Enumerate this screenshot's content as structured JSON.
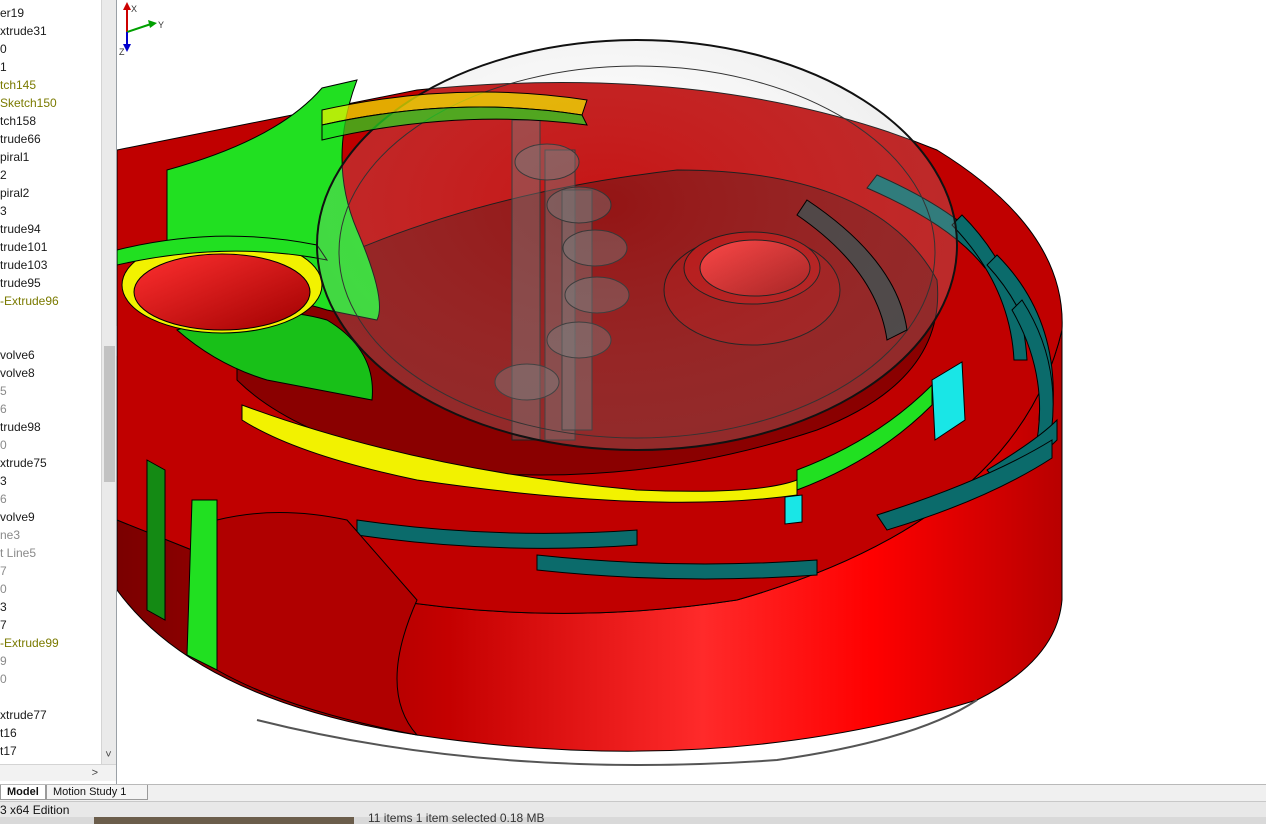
{
  "feature_tree": {
    "items": [
      {
        "label": "er19",
        "state": "normal"
      },
      {
        "label": "xtrude31",
        "state": "normal"
      },
      {
        "label": "0",
        "state": "normal"
      },
      {
        "label": "1",
        "state": "normal"
      },
      {
        "label": "tch145",
        "state": "active"
      },
      {
        "label": "Sketch150",
        "state": "active"
      },
      {
        "label": "tch158",
        "state": "normal"
      },
      {
        "label": "trude66",
        "state": "normal"
      },
      {
        "label": "piral1",
        "state": "normal"
      },
      {
        "label": "2",
        "state": "normal"
      },
      {
        "label": "piral2",
        "state": "normal"
      },
      {
        "label": "3",
        "state": "normal"
      },
      {
        "label": "trude94",
        "state": "normal"
      },
      {
        "label": "trude101",
        "state": "normal"
      },
      {
        "label": "trude103",
        "state": "normal"
      },
      {
        "label": "trude95",
        "state": "normal"
      },
      {
        "label": "-Extrude96",
        "state": "active"
      },
      {
        "label": "",
        "state": "normal"
      },
      {
        "label": "",
        "state": "normal"
      },
      {
        "label": "volve6",
        "state": "normal"
      },
      {
        "label": "volve8",
        "state": "normal"
      },
      {
        "label": "5",
        "state": "dim"
      },
      {
        "label": "6",
        "state": "dim"
      },
      {
        "label": "trude98",
        "state": "normal"
      },
      {
        "label": "0",
        "state": "dim"
      },
      {
        "label": "xtrude75",
        "state": "normal"
      },
      {
        "label": "3",
        "state": "normal"
      },
      {
        "label": "6",
        "state": "dim"
      },
      {
        "label": "volve9",
        "state": "normal"
      },
      {
        "label": "ne3",
        "state": "dim"
      },
      {
        "label": "t Line5",
        "state": "dim"
      },
      {
        "label": "7",
        "state": "dim"
      },
      {
        "label": "0",
        "state": "dim"
      },
      {
        "label": "3",
        "state": "normal"
      },
      {
        "label": "7",
        "state": "normal"
      },
      {
        "label": "-Extrude99",
        "state": "active"
      },
      {
        "label": "9",
        "state": "dim"
      },
      {
        "label": "0",
        "state": "dim"
      },
      {
        "label": "",
        "state": "normal"
      },
      {
        "label": "xtrude77",
        "state": "normal"
      },
      {
        "label": "t16",
        "state": "normal"
      },
      {
        "label": "t17",
        "state": "normal"
      }
    ],
    "scroll_down_glyph": "˅",
    "scroll_right_glyph": ">"
  },
  "splitter": {
    "glyph": "«"
  },
  "triad": {
    "x_label": "X",
    "y_label": "Y",
    "z_label": "Z"
  },
  "tabs": [
    {
      "id": "model",
      "label": "Model"
    },
    {
      "id": "motion",
      "label": "Motion Study 1"
    }
  ],
  "status": {
    "edition": "3 x64 Edition",
    "explorer": "11 items     1 item selected  0.18 MB"
  },
  "colors": {
    "part_red": "#e10000",
    "part_dark_red": "#8a0000",
    "part_green": "#21e021",
    "part_yellow": "#f2f200",
    "part_teal": "#0b6b6b",
    "part_cyan": "#19e6e6"
  }
}
